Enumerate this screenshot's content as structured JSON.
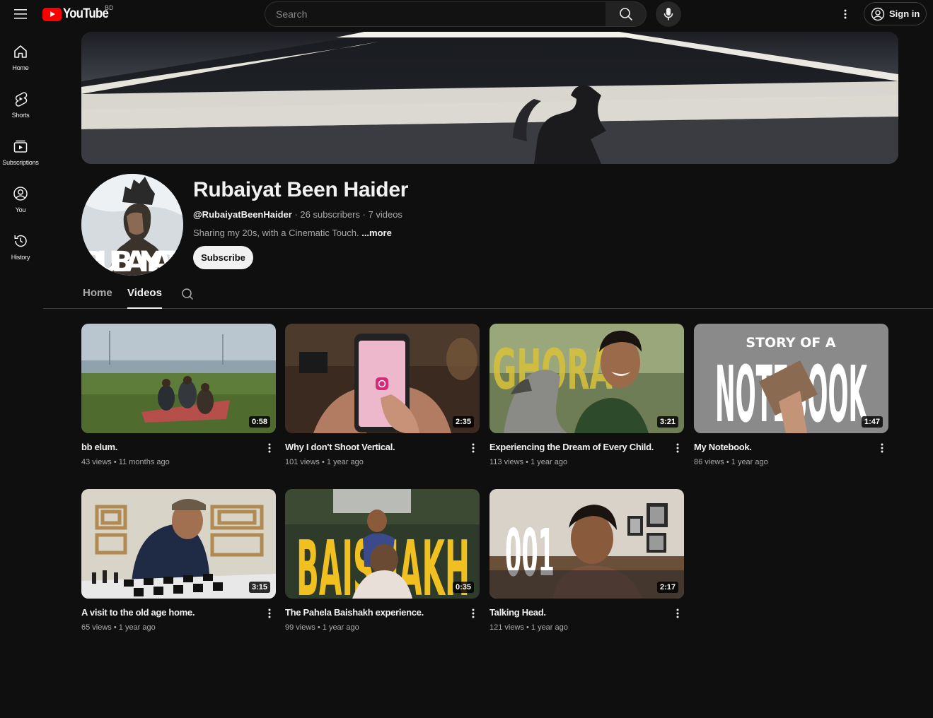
{
  "app": {
    "logo_word": "YouTube",
    "region": "BD"
  },
  "search": {
    "placeholder": "Search"
  },
  "header_actions": {
    "signin_label": "Sign in"
  },
  "guide": [
    {
      "label": "Home",
      "icon": "home-icon"
    },
    {
      "label": "Shorts",
      "icon": "shorts-icon"
    },
    {
      "label": "Subscriptions",
      "icon": "subscriptions-icon"
    },
    {
      "label": "You",
      "icon": "you-icon"
    },
    {
      "label": "History",
      "icon": "history-icon"
    }
  ],
  "channel": {
    "name": "Rubaiyat Been Haider",
    "handle": "@RubaiyatBeenHaider",
    "subscribers": "26 subscribers",
    "videos_count": "7 videos",
    "separator": " · ",
    "description": "Sharing my 20s, with a Cinematic Touch. ",
    "more_label": "...more",
    "subscribe_label": "Subscribe",
    "avatar_text": "RUBAIYAT"
  },
  "tabs": [
    {
      "label": "Home",
      "active": false
    },
    {
      "label": "Videos",
      "active": true
    }
  ],
  "videos": [
    {
      "title": "bb elum.",
      "views": "43 views",
      "age": "11 months ago",
      "duration": "0:58"
    },
    {
      "title": "Why I don't Shoot Vertical.",
      "views": "101 views",
      "age": "1 year ago",
      "duration": "2:35"
    },
    {
      "title": "Experiencing the Dream of Every Child.",
      "views": "113 views",
      "age": "1 year ago",
      "duration": "3:21",
      "thumb_text": "GHORA"
    },
    {
      "title": "My Notebook.",
      "views": "86 views",
      "age": "1 year ago",
      "duration": "1:47",
      "thumb_text_top": "STORY OF A",
      "thumb_text_main": "NOTEBOOK"
    },
    {
      "title": "A visit to the old age home.",
      "views": "65 views",
      "age": "1 year ago",
      "duration": "3:15"
    },
    {
      "title": "The Pahela Baishakh experience.",
      "views": "99 views",
      "age": "1 year ago",
      "duration": "0:35",
      "thumb_text": "BAISHAKH"
    },
    {
      "title": "Talking Head.",
      "views": "121 views",
      "age": "1 year ago",
      "duration": "2:17",
      "thumb_text": "001"
    }
  ],
  "meta_separator": " • ",
  "colors": {
    "brand_red": "#ff0000",
    "background": "#0f0f0f",
    "text_primary": "#f1f1f1",
    "text_secondary": "#aaaaaa"
  }
}
